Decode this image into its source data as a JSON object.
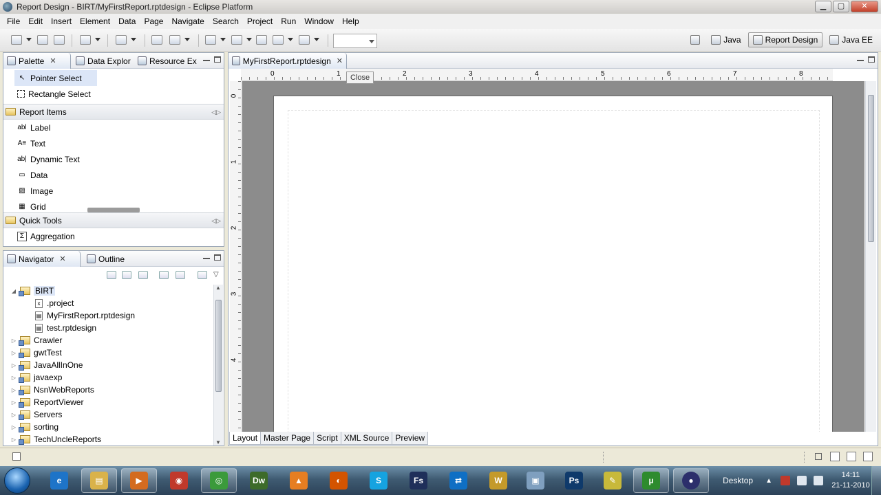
{
  "window": {
    "title": "Report Design - BIRT/MyFirstReport.rptdesign - Eclipse Platform",
    "minimize": "▁",
    "maximize": "▢",
    "close": "✕"
  },
  "menu": [
    "File",
    "Edit",
    "Insert",
    "Element",
    "Data",
    "Page",
    "Navigate",
    "Search",
    "Project",
    "Run",
    "Window",
    "Help"
  ],
  "perspectives": [
    {
      "label": "Java",
      "active": false
    },
    {
      "label": "Report Design",
      "active": true
    },
    {
      "label": "Java EE",
      "active": false
    }
  ],
  "palette_view": {
    "tabs": [
      "Palette",
      "Data Explor",
      "Resource Ex"
    ],
    "tools": [
      "Pointer Select",
      "Rectangle Select"
    ],
    "report_items_header": "Report Items",
    "report_items": [
      {
        "label": "Label",
        "icon": "abl"
      },
      {
        "label": "Text",
        "icon": "A≡"
      },
      {
        "label": "Dynamic Text",
        "icon": "ab|"
      },
      {
        "label": "Data",
        "icon": "▭"
      },
      {
        "label": "Image",
        "icon": "▨"
      },
      {
        "label": "Grid",
        "icon": "▦"
      }
    ],
    "quick_tools_header": "Quick Tools",
    "quick_tools": [
      {
        "label": "Aggregation",
        "icon": "Σ"
      }
    ]
  },
  "navigator_view": {
    "tabs": [
      "Navigator",
      "Outline"
    ],
    "tree": [
      {
        "label": "BIRT",
        "type": "project",
        "expanded": true
      },
      {
        "label": ".project",
        "type": "file"
      },
      {
        "label": "MyFirstReport.rptdesign",
        "type": "file"
      },
      {
        "label": "test.rptdesign",
        "type": "file"
      },
      {
        "label": "Crawler",
        "type": "project"
      },
      {
        "label": "gwtTest",
        "type": "project"
      },
      {
        "label": "JavaAllInOne",
        "type": "project"
      },
      {
        "label": "javaexp",
        "type": "project"
      },
      {
        "label": "NsnWebReports",
        "type": "project"
      },
      {
        "label": "ReportViewer",
        "type": "project"
      },
      {
        "label": "Servers",
        "type": "project"
      },
      {
        "label": "sorting",
        "type": "project"
      },
      {
        "label": "TechUncleReports",
        "type": "project"
      }
    ]
  },
  "editor": {
    "tab": "MyFirstReport.rptdesign",
    "tooltip": "Close",
    "ruler_h": [
      "0",
      "1",
      "2",
      "3",
      "4",
      "5",
      "6",
      "7",
      "8"
    ],
    "ruler_v": [
      "0",
      "1",
      "2",
      "3",
      "4"
    ],
    "bottom_tabs": [
      "Layout",
      "Master Page",
      "Script",
      "XML Source",
      "Preview"
    ],
    "active_bottom_tab": "Layout"
  },
  "taskbar": {
    "apps": [
      {
        "name": "internet-explorer",
        "glyph": "e",
        "color": "#1e74c8"
      },
      {
        "name": "windows-explorer",
        "glyph": "▤",
        "color": "#d9b24a"
      },
      {
        "name": "media-player",
        "glyph": "▶",
        "color": "#d36b1f"
      },
      {
        "name": "media-app",
        "glyph": "◉",
        "color": "#c0392b"
      },
      {
        "name": "chrome",
        "glyph": "◎",
        "color": "#3b9a3b"
      },
      {
        "name": "dreamweaver",
        "glyph": "Dw",
        "color": "#3d6b2a"
      },
      {
        "name": "vlc",
        "glyph": "▲",
        "color": "#e67e22"
      },
      {
        "name": "firefox",
        "glyph": "◐",
        "color": "#d35400"
      },
      {
        "name": "skype",
        "glyph": "S",
        "color": "#16a3e0"
      },
      {
        "name": "flash",
        "glyph": "Fs",
        "color": "#1f2f5a"
      },
      {
        "name": "teamviewer",
        "glyph": "⇄",
        "color": "#0f6fc4"
      },
      {
        "name": "word",
        "glyph": "W",
        "color": "#c49a2a"
      },
      {
        "name": "virtualbox",
        "glyph": "▣",
        "color": "#7f9fbf"
      },
      {
        "name": "photoshop",
        "glyph": "Ps",
        "color": "#0f3a6b"
      },
      {
        "name": "notes",
        "glyph": "✎",
        "color": "#c8b93a"
      },
      {
        "name": "utorrent",
        "glyph": "µ",
        "color": "#2e8b2e"
      },
      {
        "name": "eclipse",
        "glyph": "●",
        "color": "#2c2f6b"
      }
    ],
    "desktop_label": "Desktop",
    "time": "14:11",
    "date": "21-11-2010"
  }
}
